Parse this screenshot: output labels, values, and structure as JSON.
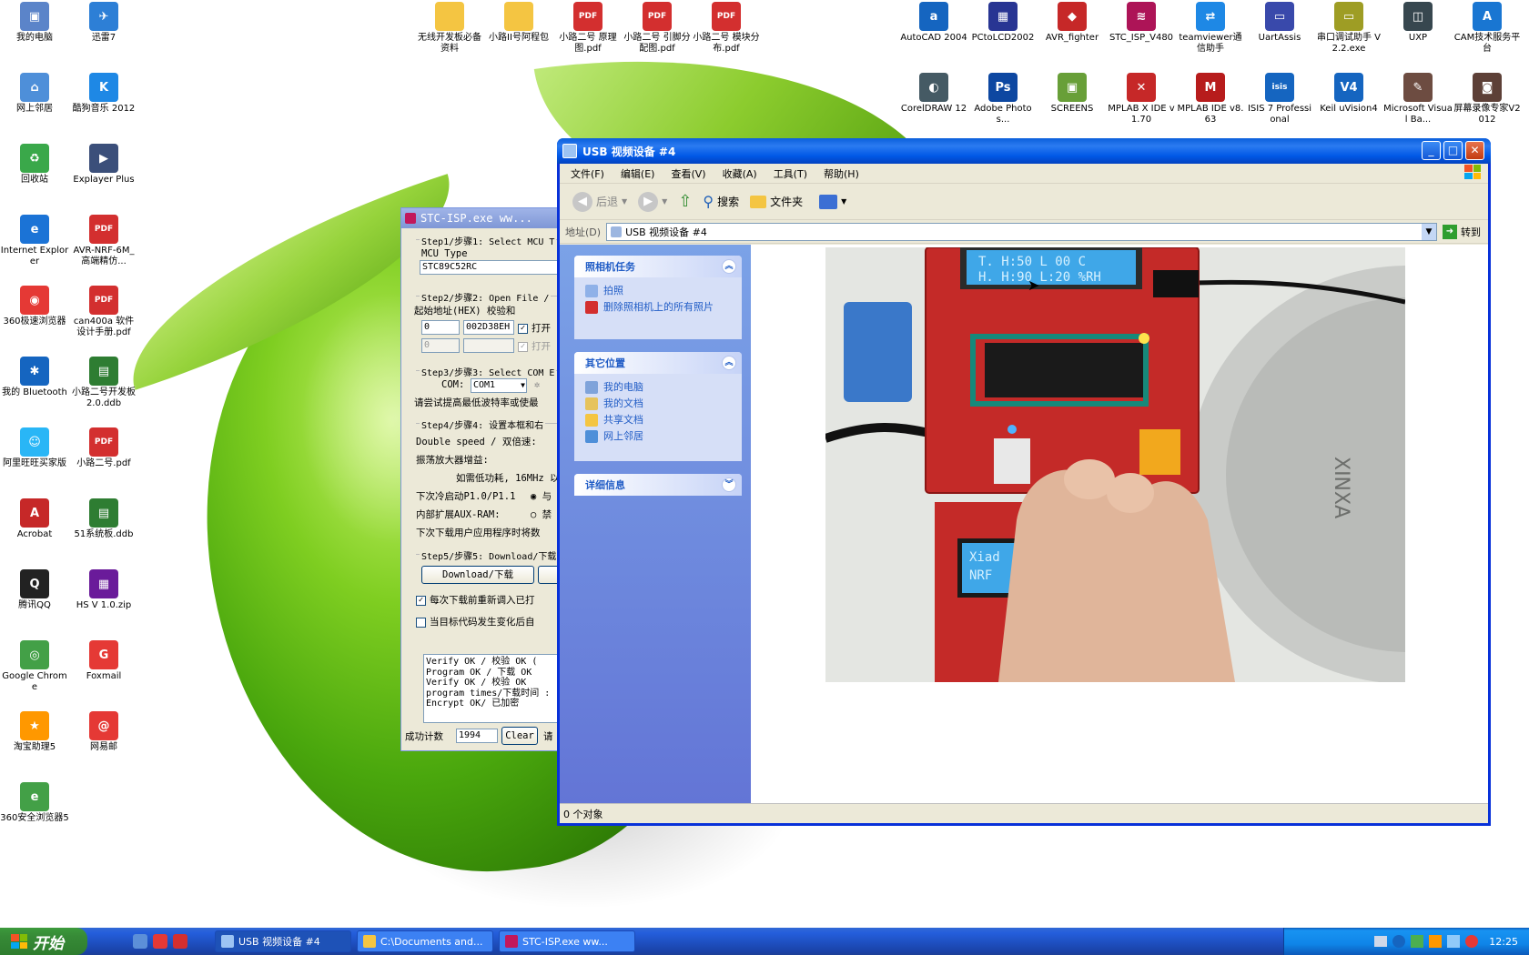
{
  "desktop_icons_left": [
    {
      "label": "我的电脑",
      "color": "#5b84c9",
      "glyph": "▣",
      "icon": "computer-icon"
    },
    {
      "label": "迅雷7",
      "color": "#2d7fd6",
      "glyph": "✈",
      "icon": "thunder-icon"
    },
    {
      "label": "网上邻居",
      "color": "#4e8fd9",
      "glyph": "⌂",
      "icon": "network-icon"
    },
    {
      "label": "酷狗音乐 2012",
      "color": "#1e88e5",
      "glyph": "K",
      "icon": "kugou-icon"
    },
    {
      "label": "回收站",
      "color": "#3aa84a",
      "glyph": "♻",
      "icon": "recycle-bin-icon"
    },
    {
      "label": "Explayer Plus",
      "color": "#3b4f7a",
      "glyph": "▶",
      "icon": "player-icon"
    },
    {
      "label": "Internet Explorer",
      "color": "#1b73d6",
      "glyph": "e",
      "icon": "ie-icon"
    },
    {
      "label": "AVR-NRF-6M_ 高端精仿...",
      "color": "#d32f2f",
      "glyph": "PDF",
      "icon": "pdf-icon"
    },
    {
      "label": "360极速浏览器",
      "color": "#e53935",
      "glyph": "◉",
      "icon": "browser-icon"
    },
    {
      "label": "can400a 软件设计手册.pdf",
      "color": "#d32f2f",
      "glyph": "PDF",
      "icon": "pdf-icon"
    },
    {
      "label": "我的 Bluetooth",
      "color": "#1565c0",
      "glyph": "✱",
      "icon": "bluetooth-icon"
    },
    {
      "label": "小路二号开发板2.0.ddb",
      "color": "#2e7d32",
      "glyph": "▤",
      "icon": "ddb-icon"
    },
    {
      "label": "阿里旺旺买家版",
      "color": "#29b6f6",
      "glyph": "☺",
      "icon": "aliwangwang-icon"
    },
    {
      "label": "小路二号.pdf",
      "color": "#d32f2f",
      "glyph": "PDF",
      "icon": "pdf-icon"
    },
    {
      "label": "Acrobat",
      "color": "#c62828",
      "glyph": "A",
      "icon": "acrobat-icon"
    },
    {
      "label": "51系统板.ddb",
      "color": "#2e7d32",
      "glyph": "▤",
      "icon": "ddb-icon"
    },
    {
      "label": "腾讯QQ",
      "color": "#222222",
      "glyph": "Q",
      "icon": "qq-icon"
    },
    {
      "label": "HS V 1.0.zip",
      "color": "#6a1b9a",
      "glyph": "▦",
      "icon": "zip-icon"
    },
    {
      "label": "Google Chrome",
      "color": "#43a047",
      "glyph": "◎",
      "icon": "chrome-icon"
    },
    {
      "label": "Foxmail",
      "color": "#e53935",
      "glyph": "G",
      "icon": "foxmail-icon"
    },
    {
      "label": "淘宝助理5",
      "color": "#ff9800",
      "glyph": "★",
      "icon": "taobao-icon"
    },
    {
      "label": "网易邮",
      "color": "#e53935",
      "glyph": "@",
      "icon": "mail-icon"
    },
    {
      "label": "360安全浏览器5",
      "color": "#43a047",
      "glyph": "e",
      "icon": "browser-360-icon"
    }
  ],
  "desktop_icons_top": [
    {
      "label": "无线开发板必备资料",
      "color": "#f4c542",
      "glyph": "",
      "icon": "folder-icon"
    },
    {
      "label": "小路II号阿程包",
      "color": "#f4c542",
      "glyph": "",
      "icon": "folder-icon"
    },
    {
      "label": "小路二号 原理图.pdf",
      "color": "#d32f2f",
      "glyph": "PDF",
      "icon": "pdf-icon"
    },
    {
      "label": "小路二号 引脚分配图.pdf",
      "color": "#d32f2f",
      "glyph": "PDF",
      "icon": "pdf-icon"
    },
    {
      "label": "小路二号 模块分布.pdf",
      "color": "#d32f2f",
      "glyph": "PDF",
      "icon": "pdf-icon"
    }
  ],
  "desktop_icons_right_row1": [
    {
      "label": "AutoCAD 2004",
      "color": "#1565c0",
      "glyph": "a",
      "icon": "autocad-icon"
    },
    {
      "label": "PCtoLCD2002",
      "color": "#283593",
      "glyph": "▦",
      "icon": "lcd-icon"
    },
    {
      "label": "AVR_fighter",
      "color": "#c62828",
      "glyph": "◆",
      "icon": "avr-icon"
    },
    {
      "label": "STC_ISP_V480",
      "color": "#ad1457",
      "glyph": "≋",
      "icon": "stc-icon"
    },
    {
      "label": "teamviewer通信助手",
      "color": "#1e88e5",
      "glyph": "⇄",
      "icon": "teamviewer-icon"
    },
    {
      "label": "UartAssis",
      "color": "#3949ab",
      "glyph": "▭",
      "icon": "serial-icon"
    },
    {
      "label": "串口调试助手 V2.2.exe",
      "color": "#9e9d24",
      "glyph": "▭",
      "icon": "serial-icon"
    },
    {
      "label": "UXP",
      "color": "#37474f",
      "glyph": "◫",
      "icon": "uxp-icon"
    },
    {
      "label": "CAM技术服务平台",
      "color": "#1976d2",
      "glyph": "A",
      "icon": "cam-icon"
    }
  ],
  "desktop_icons_right_row2": [
    {
      "label": "CorelDRAW 12",
      "color": "#455a64",
      "glyph": "◐",
      "icon": "coreldraw-icon"
    },
    {
      "label": "Adobe Photos...",
      "color": "#0d47a1",
      "glyph": "Ps",
      "icon": "photoshop-icon"
    },
    {
      "label": "SCREENS",
      "color": "#689f38",
      "glyph": "▣",
      "icon": "screen-icon"
    },
    {
      "label": "MPLAB X IDE v1.70",
      "color": "#c62828",
      "glyph": "✕",
      "icon": "mplabx-icon"
    },
    {
      "label": "MPLAB IDE v8.63",
      "color": "#b71c1c",
      "glyph": "M",
      "icon": "mplab-icon"
    },
    {
      "label": "ISIS 7 Professional",
      "color": "#1565c0",
      "glyph": "isis",
      "icon": "isis-icon"
    },
    {
      "label": "Keil uVision4",
      "color": "#1565c0",
      "glyph": "V4",
      "icon": "keil-icon"
    },
    {
      "label": "Microsoft Visual Ba...",
      "color": "#6d4c41",
      "glyph": "✎",
      "icon": "vb-icon"
    },
    {
      "label": "屏幕录像专家V2012",
      "color": "#5d4037",
      "glyph": "◙",
      "icon": "recorder-icon"
    }
  ],
  "stc": {
    "title": "STC-ISP.exe    ww...",
    "step1": "Step1/步骤1: Select MCU T",
    "mcu_type_label": "MCU Type",
    "mcu_value": "STC89C52RC",
    "step2": "Step2/步骤2: Open File /",
    "step2_sub": "起始地址(HEX) 校验和",
    "addr1": "0",
    "checksum1": "002D38EH",
    "open1": "打开",
    "addr2": "0",
    "open2": "打开",
    "step3": "Step3/步骤3: Select COM E",
    "com_label": "COM:",
    "com_value": "COM1",
    "step3_note": "请尝试提高最低波特率或使最",
    "step4": "Step4/步骤4: 设置本框和右",
    "double_speed": "Double speed / 双倍速:",
    "amp_gain": "振荡放大器增益:",
    "amp_note": "如需低功耗, 16MHz 以",
    "cold_start": "下次冷启动P1.0/P1.1",
    "cold_opt": "与",
    "aux_ram": "内部扩展AUX-RAM:",
    "aux_opt": "禁",
    "next_dl": "下次下载用户应用程序时将数",
    "step5": "Step5/步骤5: Download/下载",
    "download_btn": "Download/下载",
    "chk1": "每次下载前重新调入已打",
    "chk2": "当目标代码发生变化后自",
    "log": [
      "Verify  OK / 校验 OK  (",
      "Program OK / 下载 OK",
      "Verify  OK / 校验 OK",
      "program times/下载时间 :",
      "Encrypt OK/ 已加密"
    ],
    "count_label": "成功计数",
    "count_value": "1994",
    "clear_btn": "Clear",
    "count_trail": "请"
  },
  "explorer": {
    "title": "USB 视频设备 #4",
    "menu": [
      "文件(F)",
      "编辑(E)",
      "查看(V)",
      "收藏(A)",
      "工具(T)",
      "帮助(H)"
    ],
    "toolbar": {
      "back": "后退",
      "search": "搜索",
      "folders": "文件夹"
    },
    "address_label": "地址(D)",
    "address_value": "USB 视频设备 #4",
    "go_label": "转到",
    "camera_tasks": {
      "title": "照相机任务",
      "items": [
        "拍照",
        "删除照相机上的所有照片"
      ]
    },
    "other_places": {
      "title": "其它位置",
      "items": [
        "我的电脑",
        "我的文档",
        "共享文档",
        "网上邻居"
      ]
    },
    "details": {
      "title": "详细信息"
    },
    "status": "0 个对象",
    "video": {
      "lcd1_line1": "T. H:50 L 00 C",
      "lcd1_line2": "H. H:90 L:20 %RH",
      "lcd2_line1": "Xiad",
      "lcd2_line2": "NRF",
      "device_text": "XINXA"
    }
  },
  "taskbar": {
    "start": "开始",
    "tasks": [
      {
        "label": "USB 视频设备 #4",
        "active": true
      },
      {
        "label": "C:\\Documents and...",
        "active": false
      },
      {
        "label": "STC-ISP.exe    ww...",
        "active": false
      }
    ],
    "clock": "12:25"
  }
}
